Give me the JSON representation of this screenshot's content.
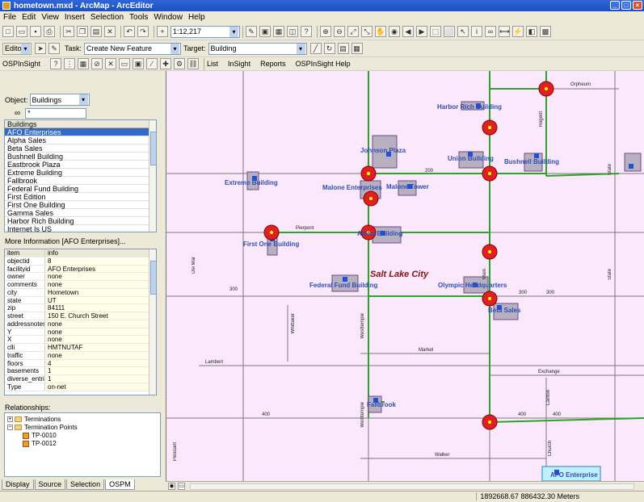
{
  "window": {
    "title": "hometown.mxd - ArcMap - ArcEditor"
  },
  "menu": [
    "File",
    "Edit",
    "View",
    "Insert",
    "Selection",
    "Tools",
    "Window",
    "Help"
  ],
  "toolbar": {
    "scale": "1:12,217",
    "editor_label": "Editor",
    "task_label": "Task:",
    "task_value": "Create New Feature",
    "target_label": "Target:",
    "target_value": "Building",
    "ospinsight": "OSPInSight",
    "menus": [
      "List",
      "InSight",
      "Reports",
      "OSPInSight Help"
    ]
  },
  "left_panel": {
    "object_label": "Object:",
    "object_value": "Buildings",
    "find_value": "*",
    "list_header": "Buildings",
    "buildings": [
      "AFO Enterprises",
      "Alpha Sales",
      "Beta Sales",
      "Bushnell Building",
      "Eastbrook Plaza",
      "Extreme Building",
      "Fallbrook",
      "Federal Fund Building",
      "First Edition",
      "First One Building",
      "Gamma Sales",
      "Harbor Rich Building",
      "Internet Is US"
    ],
    "selected": "AFO Enterprises",
    "more_info_label": "More Information [AFO Enterprises]...",
    "info_header": {
      "k": "item",
      "v": "info"
    },
    "info": [
      {
        "k": "objectid",
        "v": "8"
      },
      {
        "k": "facilityid",
        "v": "AFO Enterprises"
      },
      {
        "k": "owner",
        "v": "none"
      },
      {
        "k": "comments",
        "v": "none"
      },
      {
        "k": "city",
        "v": "Hometown"
      },
      {
        "k": "state",
        "v": "UT"
      },
      {
        "k": "zip",
        "v": "84111"
      },
      {
        "k": "street",
        "v": "150 E. Church Street"
      },
      {
        "k": "addressnotes",
        "v": "none"
      },
      {
        "k": "Y",
        "v": "none"
      },
      {
        "k": "X",
        "v": "none"
      },
      {
        "k": "clli",
        "v": "HMTNUTAF"
      },
      {
        "k": "traffic",
        "v": "none"
      },
      {
        "k": "floors",
        "v": "4"
      },
      {
        "k": "basements",
        "v": "1"
      },
      {
        "k": "diverse_entries",
        "v": "1"
      },
      {
        "k": "Type",
        "v": "on-net"
      }
    ],
    "relationships_label": "Relationships:",
    "tree": [
      "Terminations",
      "Termination Points",
      "TP-0010",
      "TP-0012"
    ],
    "tabs": [
      "Display",
      "Source",
      "Selection",
      "OSPM"
    ]
  },
  "map": {
    "city_label": "Salt Lake City",
    "buildings": [
      {
        "name": "Harbor Rich Building"
      },
      {
        "name": "Johnson Plaza"
      },
      {
        "name": "Union Building"
      },
      {
        "name": "Bushnell Building"
      },
      {
        "name": "Extreme Building"
      },
      {
        "name": "Malone Enterprises"
      },
      {
        "name": "Malone Tower"
      },
      {
        "name": "Alpha Building"
      },
      {
        "name": "First One Building"
      },
      {
        "name": "Federal Fund Building"
      },
      {
        "name": "Olympic Headquarters"
      },
      {
        "name": "Beta Sales"
      },
      {
        "name": "Fallbrook"
      },
      {
        "name": "AFO Enterprise"
      }
    ],
    "streets": [
      "Orpheum",
      "Regent",
      "State",
      "200",
      "Pierpont",
      "Dei Mar",
      "300",
      "Whittaker",
      "Westtemple",
      "Main",
      "Market",
      "Lambert",
      "Exchange",
      "Carlton",
      "400",
      "Pleasant",
      "Church",
      "Walker"
    ]
  },
  "status": {
    "coords": "1892668.67  886432.30 Meters"
  },
  "colors": {
    "map_bg": "#fce8fc",
    "road": "#7a7a7a",
    "fiber": "#2aa52a",
    "node": "#e02020",
    "building": "#b8b0c0",
    "label": "#2e4fb5"
  }
}
